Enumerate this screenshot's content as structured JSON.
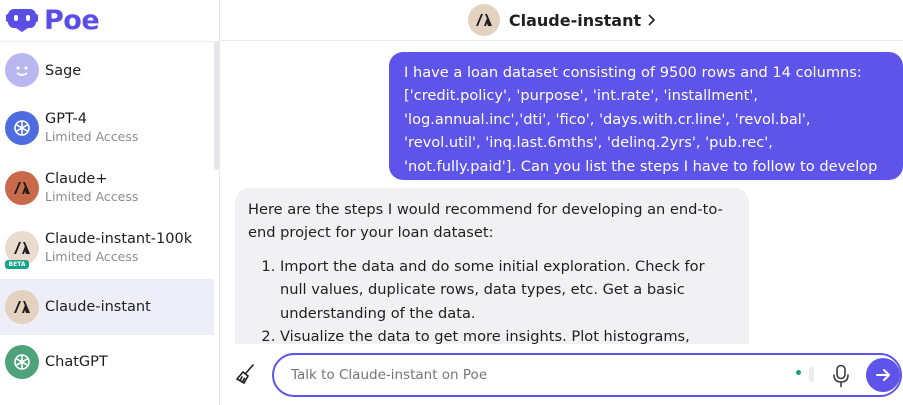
{
  "brand": {
    "name": "Poe"
  },
  "sidebar": {
    "bots": [
      {
        "name": "Sage",
        "sub": ""
      },
      {
        "name": "GPT-4",
        "sub": "Limited Access"
      },
      {
        "name": "Claude+",
        "sub": "Limited Access"
      },
      {
        "name": "Claude-instant-100k",
        "sub": "Limited Access",
        "badge": "BETA"
      },
      {
        "name": "Claude-instant",
        "sub": ""
      },
      {
        "name": "ChatGPT",
        "sub": ""
      }
    ]
  },
  "header": {
    "title": "Claude-instant"
  },
  "messages": {
    "user": "I have a loan dataset consisting of 9500 rows and 14 columns: ['credit.policy', 'purpose', 'int.rate', 'installment', 'log.annual.inc','dti', 'fico', 'days.with.cr.line', 'revol.bal', 'revol.util', 'inq.last.6mths', 'delinq.2yrs', 'pub.rec', 'not.fully.paid']. Can you list the steps I have to follow to develop an end-to-end project for my portfolio.”",
    "bot_intro": "Here are the steps I would recommend for developing an end-to-end project for your loan dataset:",
    "bot_steps": [
      "Import the data and do some initial exploration. Check for null values, duplicate rows, data types, etc. Get a basic understanding of the data.",
      "Visualize the data to get more insights. Plot histograms,"
    ]
  },
  "composer": {
    "placeholder": "Talk to Claude-instant on Poe"
  },
  "colors": {
    "accent": "#5e54e9",
    "brand": "#5b4ee6"
  }
}
